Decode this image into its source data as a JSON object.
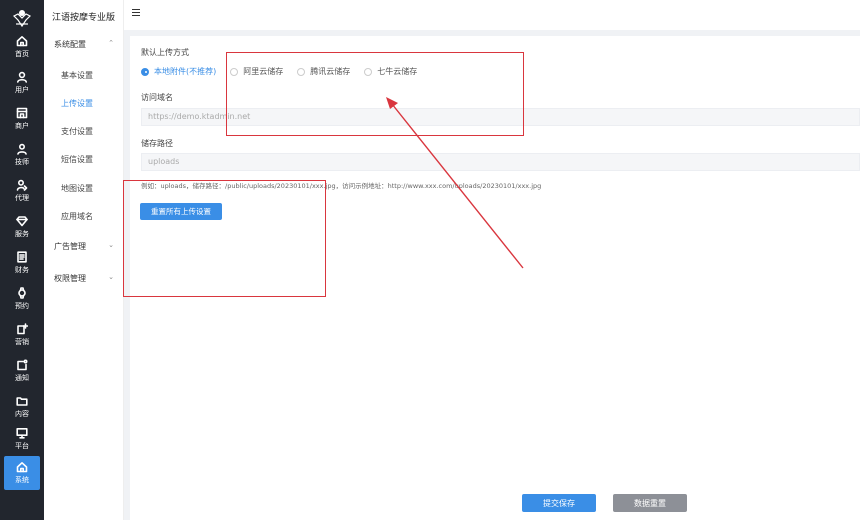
{
  "app": {
    "title": "江语按摩专业版"
  },
  "rail": {
    "items": [
      {
        "label": "首页",
        "icon": "home-icon"
      },
      {
        "label": "用户",
        "icon": "user-icon"
      },
      {
        "label": "商户",
        "icon": "store-icon"
      },
      {
        "label": "技师",
        "icon": "technician-icon"
      },
      {
        "label": "代理",
        "icon": "agent-icon"
      },
      {
        "label": "服务",
        "icon": "diamond-icon"
      },
      {
        "label": "财务",
        "icon": "ledger-icon"
      },
      {
        "label": "预约",
        "icon": "watch-icon"
      },
      {
        "label": "营销",
        "icon": "marketing-icon"
      },
      {
        "label": "通知",
        "icon": "notice-icon"
      },
      {
        "label": "内容",
        "icon": "folder-icon"
      },
      {
        "label": "平台",
        "icon": "monitor-icon"
      },
      {
        "label": "系统",
        "icon": "home-icon",
        "active": true
      }
    ]
  },
  "submenu": {
    "groups": [
      {
        "label": "系统配置",
        "expanded": true,
        "items": [
          "基本设置",
          "上传设置",
          "支付设置",
          "短信设置",
          "地图设置",
          "应用域名"
        ],
        "active_item": "上传设置"
      },
      {
        "label": "广告管理",
        "expanded": false
      },
      {
        "label": "权限管理",
        "expanded": false
      }
    ]
  },
  "form": {
    "upload_method_label": "默认上传方式",
    "upload_options": [
      {
        "label": "本地附件(不推荐)",
        "checked": true
      },
      {
        "label": "阿里云储存",
        "checked": false
      },
      {
        "label": "腾讯云储存",
        "checked": false
      },
      {
        "label": "七牛云储存",
        "checked": false
      }
    ],
    "domain_label": "访问域名",
    "domain_value": "https://demo.ktadmin.net",
    "path_label": "储存路径",
    "path_value": "uploads",
    "hint": "例如：uploads，储存路径：/public/uploads/20230101/xxx.jpg，访问示例地址：http://www.xxx.com/uploads/20230101/xxx.jpg",
    "reset_label": "重置所有上传设置"
  },
  "footer": {
    "submit_label": "提交保存",
    "restore_label": "数据重置"
  },
  "colors": {
    "accent": "#3a8ee6",
    "rail_bg": "#22262e",
    "annotation": "#d9363e",
    "secondary_button": "#8d9097"
  }
}
